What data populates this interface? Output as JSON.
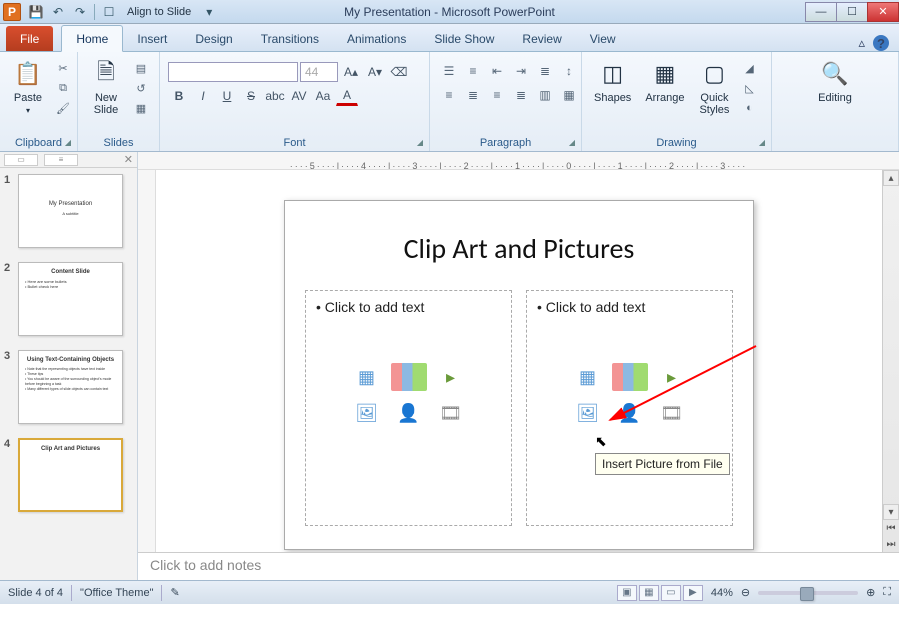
{
  "titlebar": {
    "app_letter": "P",
    "align_label": "Align to Slide",
    "title": "My Presentation - Microsoft PowerPoint"
  },
  "tabs": {
    "file": "File",
    "list": [
      "Home",
      "Insert",
      "Design",
      "Transitions",
      "Animations",
      "Slide Show",
      "Review",
      "View"
    ],
    "active_index": 0
  },
  "ribbon": {
    "clipboard": {
      "paste": "Paste",
      "label": "Clipboard"
    },
    "slides": {
      "new_slide": "New\nSlide",
      "label": "Slides"
    },
    "font": {
      "size": "44",
      "label": "Font"
    },
    "paragraph": {
      "label": "Paragraph"
    },
    "drawing": {
      "shapes": "Shapes",
      "arrange": "Arrange",
      "quick_styles": "Quick\nStyles",
      "label": "Drawing"
    },
    "editing": {
      "label": "Editing"
    }
  },
  "ruler_marks": "····5····|····4····|····3····|····2····|····1····|····0····|····1····|····2····|····3····",
  "thumbs": [
    {
      "num": "1",
      "title": "My Presentation",
      "sub": "A subtitle"
    },
    {
      "num": "2",
      "title": "Content Slide",
      "lines": 2
    },
    {
      "num": "3",
      "title": "Using Text-Containing Objects",
      "lines": 4
    },
    {
      "num": "4",
      "title": "Clip Art and Pictures",
      "lines": 0,
      "selected": true
    }
  ],
  "slide": {
    "title": "Clip Art and Pictures",
    "placeholder": "Click to add text",
    "tooltip": "Insert Picture from File"
  },
  "notes": {
    "placeholder": "Click to add notes"
  },
  "status": {
    "slide_of": "Slide 4 of 4",
    "theme": "\"Office Theme\"",
    "zoom": "44%"
  }
}
